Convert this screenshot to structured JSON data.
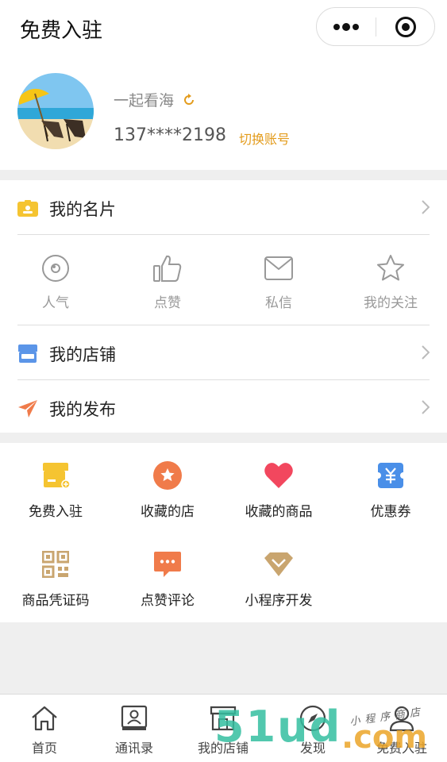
{
  "header": {
    "title": "免费入驻"
  },
  "profile": {
    "nickname": "一起看海",
    "phone": "137****2198",
    "switch_label": "切换账号"
  },
  "card": {
    "business_card_label": "我的名片",
    "stats": [
      {
        "label": "人气",
        "icon": "eye-icon"
      },
      {
        "label": "点赞",
        "icon": "thumbs-up-icon"
      },
      {
        "label": "私信",
        "icon": "mail-icon"
      },
      {
        "label": "我的关注",
        "icon": "star-icon"
      }
    ],
    "shop_label": "我的店铺",
    "publish_label": "我的发布"
  },
  "grid": [
    {
      "label": "免费入驻",
      "icon": "store-plus-icon",
      "color": "#f5c431"
    },
    {
      "label": "收藏的店",
      "icon": "star-circle-icon",
      "color": "#f07b4a"
    },
    {
      "label": "收藏的商品",
      "icon": "heart-icon",
      "color": "#f2475e"
    },
    {
      "label": "优惠券",
      "icon": "coupon-icon",
      "color": "#4a8fe8"
    },
    {
      "label": "商品凭证码",
      "icon": "qr-code-icon",
      "color": "#c9a56f"
    },
    {
      "label": "点赞评论",
      "icon": "comment-icon",
      "color": "#f07b4a"
    },
    {
      "label": "小程序开发",
      "icon": "diamond-icon",
      "color": "#c9a56f"
    }
  ],
  "tabbar": [
    {
      "label": "首页",
      "icon": "home-icon"
    },
    {
      "label": "通讯录",
      "icon": "contacts-icon"
    },
    {
      "label": "我的店铺",
      "icon": "shop-icon"
    },
    {
      "label": "发现",
      "icon": "compass-icon"
    },
    {
      "label": "免费入驻",
      "icon": "user-icon"
    }
  ],
  "watermark": {
    "brand": "51ud",
    "suffix": ".com",
    "handwriting": "小程序商店"
  },
  "colors": {
    "accent": "#e39b1b",
    "muted": "#999999"
  }
}
